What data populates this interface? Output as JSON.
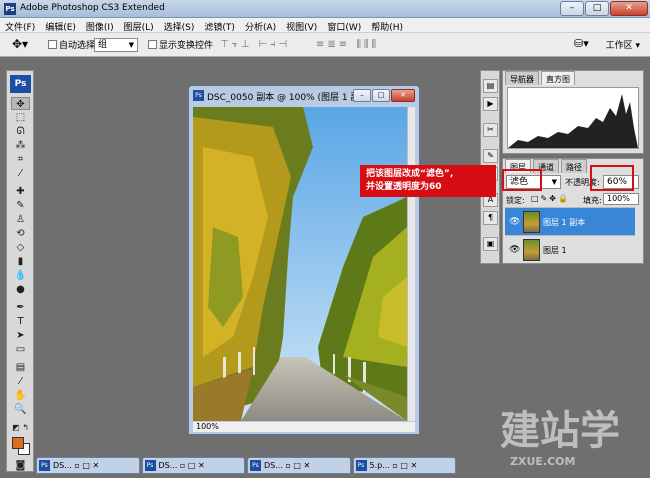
{
  "app": {
    "title": "Adobe Photoshop CS3 Extended",
    "logo": "Ps"
  },
  "window_buttons": [
    "–",
    "□",
    "✕"
  ],
  "menu": [
    "文件(F)",
    "编辑(E)",
    "图像(I)",
    "图层(L)",
    "选择(S)",
    "滤镜(T)",
    "分析(A)",
    "视图(V)",
    "窗口(W)",
    "帮助(H)"
  ],
  "options": {
    "auto_select_label": "自动选择:",
    "auto_select_value": "组",
    "show_transform_label": "显示变换控件",
    "workspace_label": "工作区"
  },
  "document": {
    "title": "DSC_0050 副本 @ 100% (图层 1 副...",
    "zoom": "100%"
  },
  "histogram_panel": {
    "tabs": [
      "导航器",
      "直方图"
    ]
  },
  "layers_panel": {
    "tabs": [
      "图层",
      "通道",
      "路径"
    ],
    "blend_mode": "滤色",
    "opacity_label": "不透明度:",
    "opacity_value": "60%",
    "lock_label": "锁定:",
    "fill_label": "填充:",
    "fill_value": "100%",
    "layers": [
      {
        "name": "图层 1 副本",
        "active": true
      },
      {
        "name": "图层 1",
        "active": false
      }
    ]
  },
  "annotation": {
    "line1": "把该图层改成“滤色”,",
    "line2": "并设置透明度为60"
  },
  "minimized_docs": [
    "DS...",
    "DS...",
    "DS...",
    "5.p..."
  ],
  "watermark": {
    "main": "建站学",
    "sub": "ZXUE.COM"
  },
  "colors": {
    "foreground": "#d96f1e",
    "background": "#ffffff",
    "annotation_red": "#d60e14",
    "selected_layer": "#3a86d6"
  }
}
